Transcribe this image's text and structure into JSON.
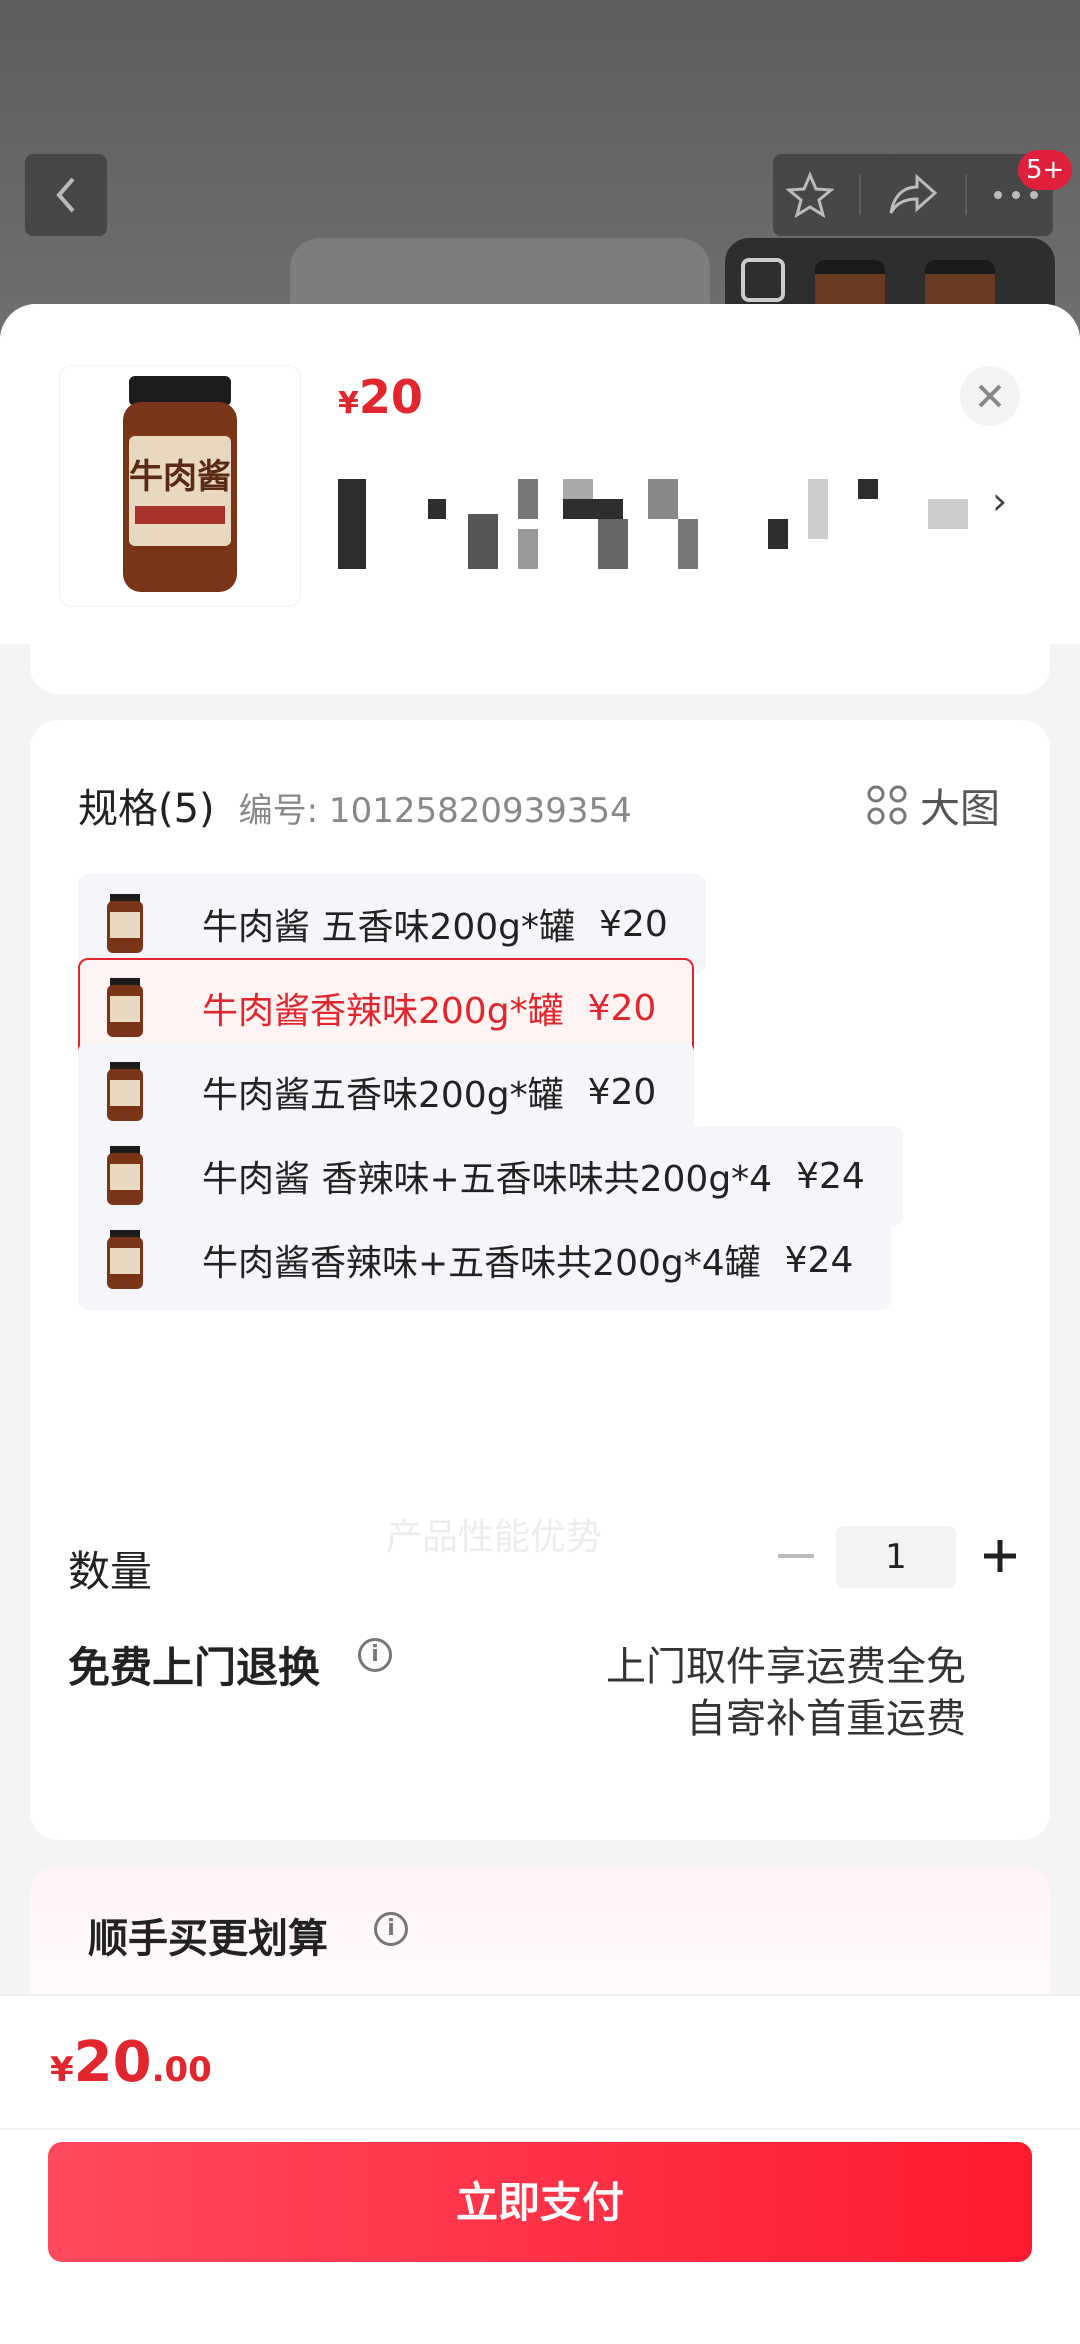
{
  "header": {
    "badge": "5+"
  },
  "product": {
    "price_currency": "¥",
    "price_value": "20"
  },
  "spec": {
    "title": "规格(5)",
    "code": "编号: 10125820939354",
    "bigpic_label": "大图",
    "options": [
      {
        "label": "牛肉酱 五香味200g*罐",
        "price": "¥20",
        "selected": false
      },
      {
        "label": "牛肉酱香辣味200g*罐",
        "price": "¥20",
        "selected": true
      },
      {
        "label": "牛肉酱五香味200g*罐",
        "price": "¥20",
        "selected": false
      },
      {
        "label": "牛肉酱 香辣味+五香味味共200g*4",
        "price": "¥24",
        "selected": false
      },
      {
        "label": "牛肉酱香辣味+五香味共200g*4罐",
        "price": "¥24",
        "selected": false
      }
    ],
    "watermark": "产品性能优势"
  },
  "quantity": {
    "label": "数量",
    "value": "1"
  },
  "returns": {
    "label": "免费上门退换",
    "line1": "上门取件享运费全免",
    "line2": "自寄补首重运费"
  },
  "deal": {
    "title": "顺手买更划算"
  },
  "footer": {
    "currency": "¥",
    "total_int": "20",
    "total_dec": ".00",
    "pay_label": "立即支付"
  },
  "colors": {
    "accent": "#e1262d",
    "pay_gradient_start": "#ff4a5e",
    "pay_gradient_end": "#ff1a30"
  }
}
